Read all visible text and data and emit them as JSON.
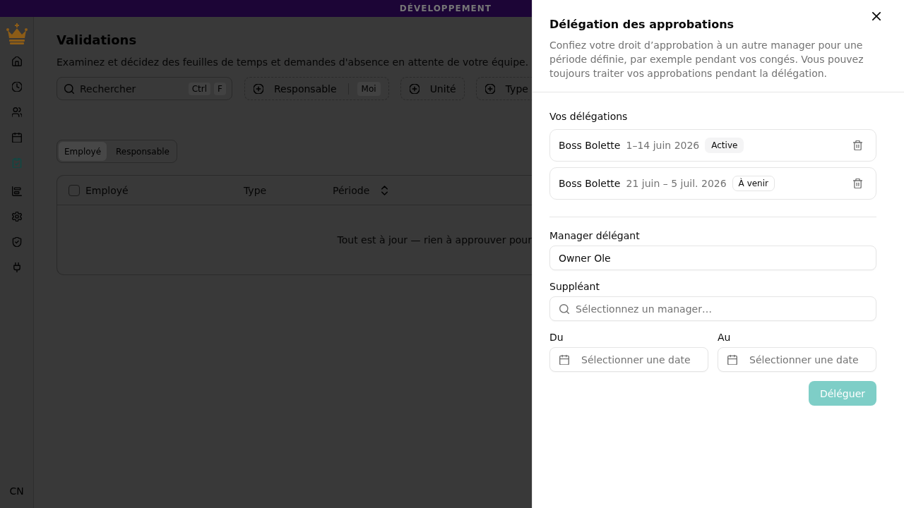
{
  "env_banner": {
    "label": "DÉVELOPPEMENT"
  },
  "sidebar": {
    "sections": [
      {
        "items": [
          {
            "selected": false
          },
          {
            "selected": false
          },
          {
            "selected": false
          },
          {
            "selected": false
          },
          {
            "selected": true
          }
        ]
      },
      {
        "items": [
          {
            "selected": false
          },
          {
            "selected": false
          },
          {
            "selected": false
          },
          {
            "selected": false
          }
        ]
      }
    ],
    "user_initials": "CN"
  },
  "page": {
    "title": "Validations",
    "description": "Examinez et décidez des feuilles de temps et demandes d'absence en attente de votre équipe."
  },
  "filters": {
    "search": {
      "placeholder": "Rechercher",
      "shortcut": [
        "Ctrl",
        "F"
      ]
    },
    "chips": [
      {
        "label": "Responsable",
        "value": "Moi"
      },
      {
        "label": "Unité"
      },
      {
        "label": "Type"
      }
    ]
  },
  "view_toggle": [
    {
      "label": "Employé",
      "selected": true
    },
    {
      "label": "Responsable",
      "selected": false
    }
  ],
  "table": {
    "select_all": {
      "checked": false
    },
    "columns": [
      {
        "label": "Employé",
        "sortable": false
      },
      {
        "label": "Type",
        "sortable": false
      },
      {
        "label": "Période",
        "sortable": true
      }
    ],
    "empty_message": "Tout est à jour — rien à approuver pour"
  },
  "sheet": {
    "title": "Délégation des approbations",
    "description": "Confiez votre droit d’approbation à un autre manager pour une période définie, par exemple pendant vos congés. Vous pouvez toujours traiter vos approbations pendant la délégation.",
    "delegations_heading": "Vos délégations",
    "delegations": [
      {
        "name": "Boss Bolette",
        "period": "1–14 juin 2026",
        "status": "Active",
        "kind": "secondary"
      },
      {
        "name": "Boss Bolette",
        "period": "21 juin – 5 juil. 2026",
        "status": "À venir",
        "kind": "outline"
      }
    ],
    "form": {
      "delegator": {
        "label": "Manager délégant",
        "value": "Owner Ole"
      },
      "substitute": {
        "label": "Suppléant",
        "placeholder": "Sélectionnez un manager…"
      },
      "from": {
        "label": "Du",
        "placeholder": "Sélectionner une date"
      },
      "to": {
        "label": "Au",
        "placeholder": "Sélectionner une date"
      }
    },
    "submit": {
      "label": "Déléguer",
      "disabled": true
    }
  }
}
